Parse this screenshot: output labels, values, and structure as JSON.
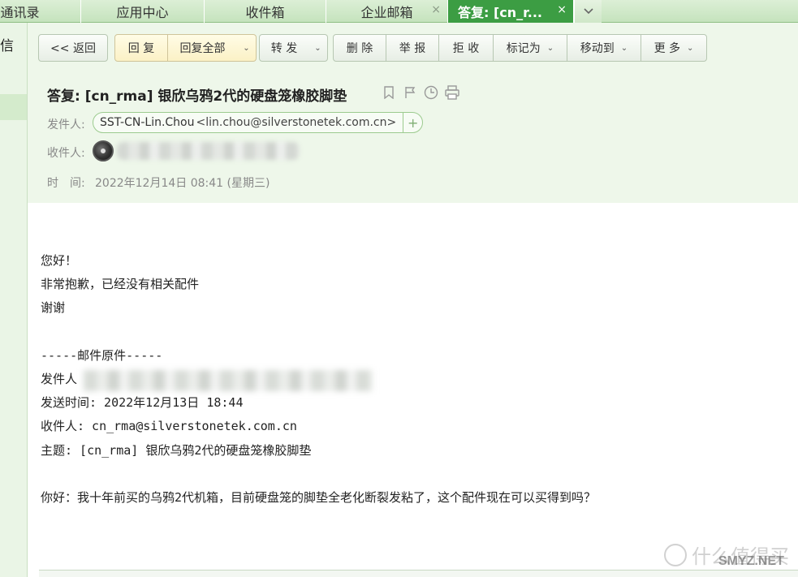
{
  "tabs": [
    {
      "label": "通讯录",
      "close": ""
    },
    {
      "label": "应用中心",
      "close": ""
    },
    {
      "label": "收件箱",
      "close": ""
    },
    {
      "label": "企业邮箱",
      "close": "×"
    },
    {
      "label": "答复: [cn_r...",
      "close": "×"
    }
  ],
  "tab_more_icon": "chevron-down-icon",
  "leftnav": {
    "label": "信"
  },
  "toolbar": {
    "back": "<< 返回",
    "reply": "回 复",
    "reply_all": "回复全部",
    "forward": "转 发",
    "delete": "删 除",
    "report": "举 报",
    "reject": "拒 收",
    "mark_as": "标记为",
    "move_to": "移动到",
    "more": "更 多"
  },
  "message": {
    "subject": "答复: [cn_rma] 银欣乌鸦2代的硬盘笼橡胶脚垫",
    "subject_icons": [
      "bookmark-icon",
      "flag-icon",
      "clock-icon",
      "print-icon"
    ],
    "from_label": "发件人:",
    "from_name": "SST-CN-Lin.Chou",
    "from_address": "<lin.chou@silverstonetek.com.cn>",
    "to_label": "收件人:",
    "time_label": "时　间:",
    "time_value": "2022年12月14日 08:41 (星期三)"
  },
  "body": {
    "greeting": "您好！",
    "line1": "非常抱歉，已经没有相关配件",
    "line2": "谢谢",
    "original_divider": "-----邮件原件-----",
    "orig_from_label": "发件人",
    "orig_sent": "发送时间: 2022年12月13日  18:44",
    "orig_to": "收件人: cn_rma@silverstonetek.com.cn",
    "orig_subject": "主题: [cn_rma] 银欣乌鸦2代的硬盘笼橡胶脚垫",
    "orig_content": "你好：我十年前买的乌鸦2代机箱，目前硬盘笼的脚垫全老化断裂发粘了，这个配件现在可以买得到吗？"
  },
  "watermark": {
    "text": "什么值得买",
    "site": "SMYZ.NET"
  }
}
